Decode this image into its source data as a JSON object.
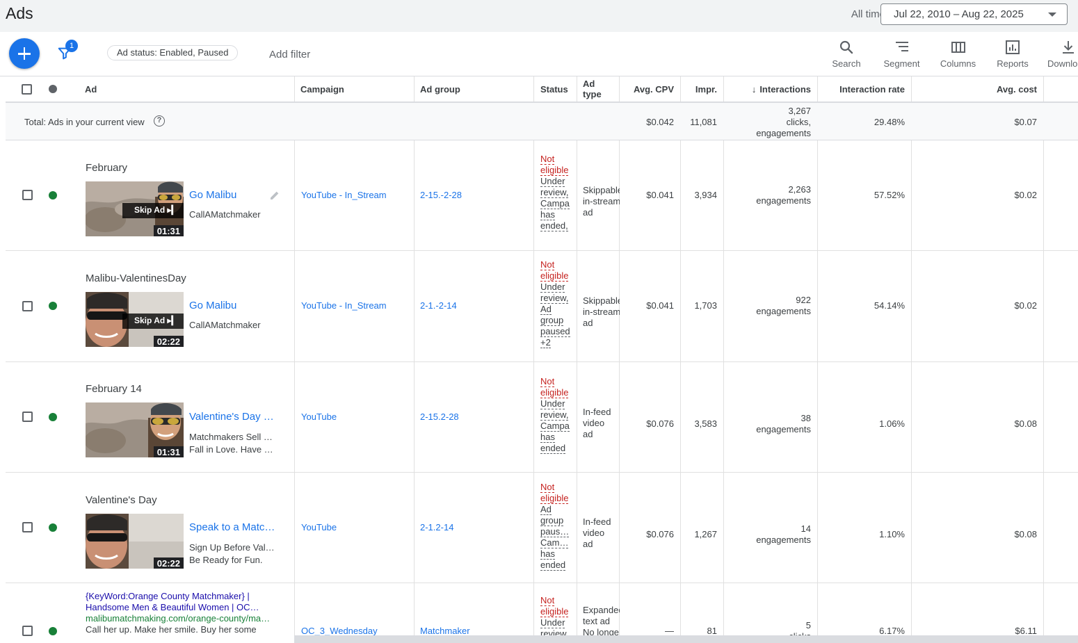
{
  "header": {
    "title": "Ads",
    "range_label": "All time",
    "date_range": "Jul 22, 2010 – Aug 22, 2025"
  },
  "toolbar": {
    "filter_count": "1",
    "filter_chip": "Ad status: Enabled, Paused",
    "add_filter": "Add filter",
    "tools": [
      "Search",
      "Segment",
      "Columns",
      "Reports",
      "Download"
    ]
  },
  "columns": {
    "ad": "Ad",
    "campaign": "Campaign",
    "ad_group": "Ad group",
    "status": "Status",
    "ad_type": "Ad type",
    "avg_cpv": "Avg. CPV",
    "impr": "Impr.",
    "interactions": "Interactions",
    "interaction_rate": "Interaction rate",
    "avg_cost": "Avg. cost"
  },
  "total": {
    "label": "Total: Ads in your current view",
    "avg_cpv": "$0.042",
    "impr": "11,081",
    "interactions": [
      "3,267",
      "clicks,",
      "engagements"
    ],
    "interaction_rate": "29.48%",
    "avg_cost": "$0.07"
  },
  "rows": [
    {
      "name": "February",
      "title": "Go Malibu",
      "subtitle": [
        "CallAMatchmaker"
      ],
      "duration": "01:31",
      "skip": "Skip Ad ▸▎",
      "campaign": "YouTube - In_Stream",
      "ad_group": "2-15.-2-28",
      "status_main": [
        "Not",
        "eligible"
      ],
      "status_reason": [
        "Under",
        "review,",
        "Campa",
        "has",
        "ended,"
      ],
      "ad_type": [
        "Skippable",
        "in-stream",
        "ad"
      ],
      "avg_cpv": "$0.041",
      "impr": "3,934",
      "interactions": [
        "2,263",
        "engagements"
      ],
      "interaction_rate": "57.52%",
      "avg_cost": "$0.02"
    },
    {
      "name": "Malibu-ValentinesDay",
      "title": "Go Malibu",
      "subtitle": [
        "CallAMatchmaker"
      ],
      "duration": "02:22",
      "skip": "Skip Ad ▸▎",
      "campaign": "YouTube - In_Stream",
      "ad_group": "2-1.-2-14",
      "status_main": [
        "Not",
        "eligible"
      ],
      "status_reason": [
        "Under",
        "review,",
        "Ad",
        "group",
        "paused",
        "+2"
      ],
      "ad_type": [
        "Skippable",
        "in-stream",
        "ad"
      ],
      "avg_cpv": "$0.041",
      "impr": "1,703",
      "interactions": [
        "922",
        "engagements"
      ],
      "interaction_rate": "54.14%",
      "avg_cost": "$0.02"
    },
    {
      "name": "February 14",
      "title": "Valentine's Day …",
      "subtitle": [
        "Matchmakers Sell …",
        "Fall in Love. Have …"
      ],
      "duration": "01:31",
      "campaign": "YouTube",
      "ad_group": "2-15.2-28",
      "status_main": [
        "Not",
        "eligible"
      ],
      "status_reason": [
        "Under",
        "review,",
        "Campa",
        "has",
        "ended"
      ],
      "ad_type": [
        "In-feed",
        "video",
        "ad"
      ],
      "avg_cpv": "$0.076",
      "impr": "3,583",
      "interactions": [
        "38",
        "engagements"
      ],
      "interaction_rate": "1.06%",
      "avg_cost": "$0.08"
    },
    {
      "name": "Valentine's Day",
      "title": "Speak to a Matc…",
      "subtitle": [
        "Sign Up Before Val…",
        "Be Ready for Fun."
      ],
      "duration": "02:22",
      "campaign": "YouTube",
      "ad_group": "2-1.2-14",
      "status_main": [
        "Not",
        "eligible"
      ],
      "status_reason": [
        "Ad",
        "group",
        "paus…",
        "Cam…",
        "has",
        "ended"
      ],
      "ad_type": [
        "In-feed",
        "video",
        "ad"
      ],
      "avg_cpv": "$0.076",
      "impr": "1,267",
      "interactions": [
        "14",
        "engagements"
      ],
      "interaction_rate": "1.10%",
      "avg_cost": "$0.08"
    },
    {
      "text_ad_lines": [
        "{KeyWord:Orange County Matchmaker} |",
        "Handsome Men & Beautiful Women | OC…",
        "malibumatchmaking.com/orange-county/ma…",
        "Call her up. Make her smile. Buy her some"
      ],
      "campaign": "OC_3_Wednesday",
      "ad_group": "Matchmaker",
      "status_main": [
        "Not",
        "eligible"
      ],
      "status_reason": [
        "Under",
        "review"
      ],
      "ad_type": [
        "Expanded",
        "text ad",
        "No longe"
      ],
      "avg_cpv": "—",
      "impr": "81",
      "interactions": [
        "5",
        "clicks"
      ],
      "interaction_rate": "6.17%",
      "avg_cost": "$6.11"
    }
  ],
  "colors": {
    "accent": "#1a73e8",
    "status_error": "#c5221f",
    "enabled_dot": "#188038"
  }
}
